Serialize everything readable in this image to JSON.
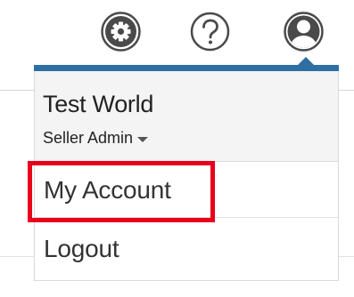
{
  "toolbar": {
    "icons": [
      "gear-icon",
      "help-icon",
      "user-avatar-icon"
    ]
  },
  "user_menu": {
    "name": "Test World",
    "role": "Seller Admin",
    "items": [
      {
        "label": "My Account"
      },
      {
        "label": "Logout"
      }
    ]
  },
  "colors": {
    "accent": "#2d6fa3",
    "highlight": "#e8001c",
    "header_bg": "#f4f4f4",
    "icon_dark": "#4a4a4a"
  }
}
